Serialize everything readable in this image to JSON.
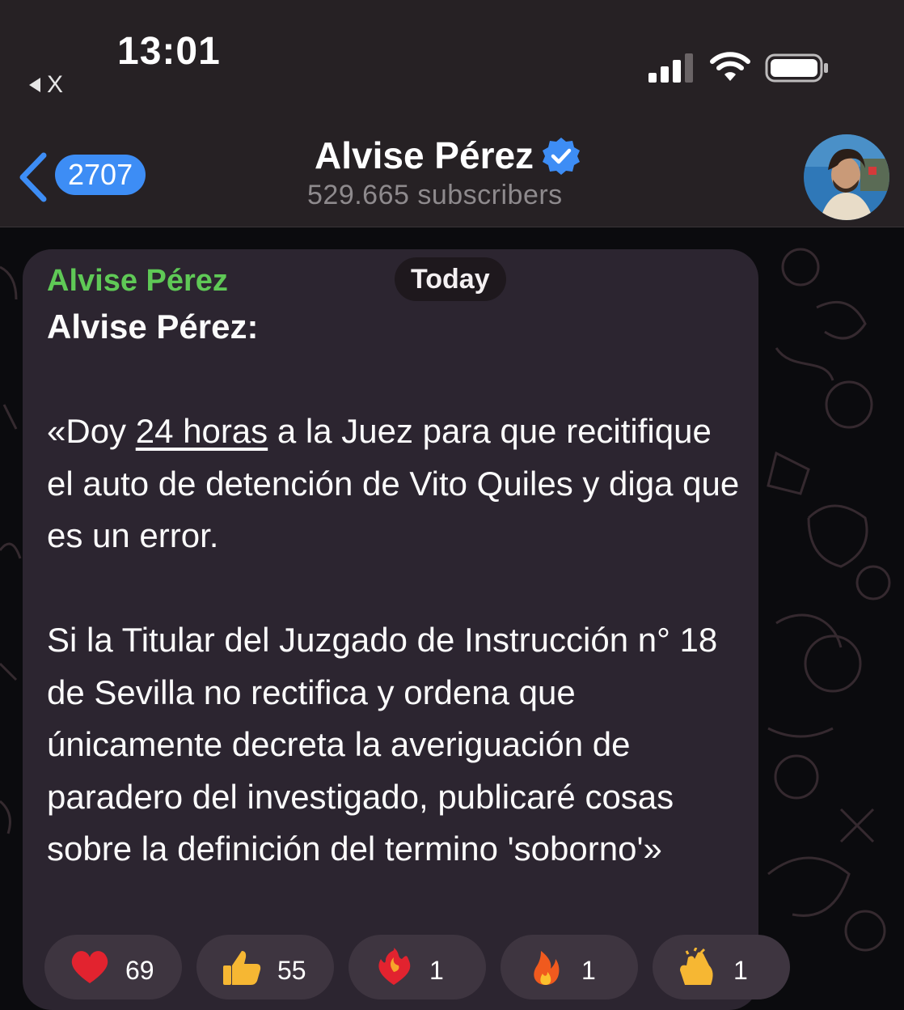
{
  "status_bar": {
    "time": "13:01",
    "back_app": "X"
  },
  "header": {
    "back_count": "2707",
    "title": "Alvise Pérez",
    "subtitle": "529.665 subscribers"
  },
  "message": {
    "sender": "Alvise Pérez",
    "date_pill": "Today",
    "heading": "Alvise Pérez:",
    "p1_before": "«Doy ",
    "p1_link": "24 horas",
    "p1_after": " a la Juez para que recitifique el auto de detención de Vito Quiles y diga que es un error.",
    "p2": "Si la Titular del Juzgado de Instrucción n° 18 de Sevilla no rectifica y ordena que únicamente decreta la averiguación de paradero del investigado, publicaré cosas sobre la definición del termino 'soborno'»"
  },
  "reactions": [
    {
      "icon": "heart-emoji",
      "count": "69"
    },
    {
      "icon": "thumbs-up-emoji",
      "count": "55"
    },
    {
      "icon": "heart-on-fire-emoji",
      "count": "1"
    },
    {
      "icon": "fire-emoji",
      "count": "1"
    },
    {
      "icon": "clapping-hands-emoji",
      "count": "1"
    }
  ],
  "colors": {
    "accent_blue": "#3d8df5",
    "sender_green": "#5fc956",
    "bubble": "#2c2530"
  }
}
